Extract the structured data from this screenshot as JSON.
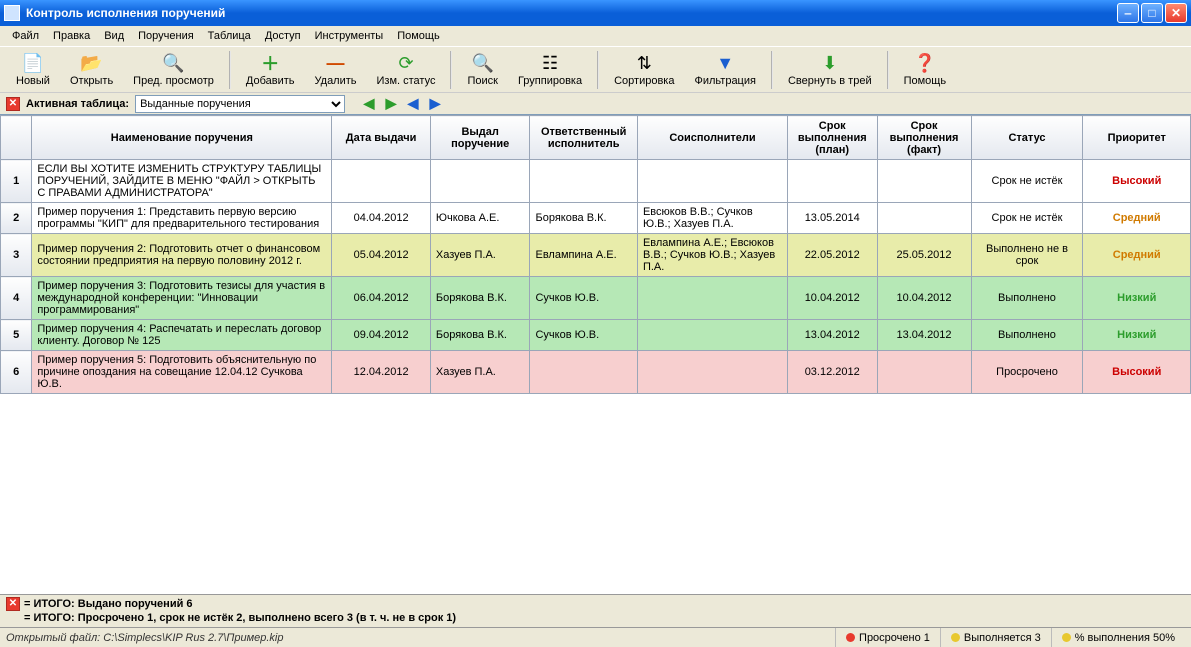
{
  "window": {
    "title": "Контроль исполнения поручений"
  },
  "menu": {
    "file": "Файл",
    "edit": "Правка",
    "view": "Вид",
    "orders": "Поручения",
    "table": "Таблица",
    "access": "Доступ",
    "tools": "Инструменты",
    "help": "Помощь"
  },
  "toolbar": {
    "new": "Новый",
    "open": "Открыть",
    "preview": "Пред. просмотр",
    "add": "Добавить",
    "delete": "Удалить",
    "chstatus": "Изм. статус",
    "search": "Поиск",
    "group": "Группировка",
    "sort": "Сортировка",
    "filter": "Фильтрация",
    "tray": "Свернуть в трей",
    "help": "Помощь"
  },
  "activebar": {
    "label": "Активная таблица:",
    "selected": "Выданные поручения"
  },
  "columns": {
    "idx": "",
    "name": "Наименование поручения",
    "date": "Дата выдачи",
    "issuer": "Выдал поручение",
    "responsible": "Ответственный исполнитель",
    "co": "Соисполнители",
    "plan": "Срок выполнения (план)",
    "fact": "Срок выполнения (факт)",
    "status": "Статус",
    "priority": "Приоритет"
  },
  "rows": [
    {
      "n": "1",
      "cls": "row-dashed",
      "name": "ЕСЛИ ВЫ ХОТИТЕ ИЗМЕНИТЬ СТРУКТУРУ ТАБЛИЦЫ ПОРУЧЕНИЙ, ЗАЙДИТЕ В МЕНЮ \"ФАЙЛ > ОТКРЫТЬ С ПРАВАМИ АДМИНИСТРАТОРА\"",
      "date": "",
      "issuer": "",
      "responsible": "",
      "co": "",
      "plan": "",
      "fact": "",
      "status": "Срок не истёк",
      "priority": "Высокий",
      "prioCls": "prio-high"
    },
    {
      "n": "2",
      "cls": "",
      "name": "Пример поручения 1: Представить первую версию программы \"КИП\" для предварительного тестирования",
      "date": "04.04.2012",
      "issuer": "Ючкова А.Е.",
      "responsible": "Борякова В.К.",
      "co": "Евсюков В.В.; Сучков Ю.В.; Хазуев П.А.",
      "plan": "13.05.2014",
      "fact": "",
      "status": "Срок не истёк",
      "priority": "Средний",
      "prioCls": "prio-med"
    },
    {
      "n": "3",
      "cls": "row-yellow",
      "name": "Пример поручения 2: Подготовить отчет о финансовом состоянии предприятия на первую половину 2012 г.",
      "date": "05.04.2012",
      "issuer": "Хазуев П.А.",
      "responsible": "Евлампина А.Е.",
      "co": "Евлампина А.Е.; Евсюков В.В.; Сучков Ю.В.; Хазуев П.А.",
      "plan": "22.05.2012",
      "fact": "25.05.2012",
      "status": "Выполнено не в срок",
      "priority": "Средний",
      "prioCls": "prio-med"
    },
    {
      "n": "4",
      "cls": "row-green",
      "name": "Пример поручения 3: Подготовить тезисы для участия в международной конференции: \"Инновации программирования\"",
      "date": "06.04.2012",
      "issuer": "Борякова В.К.",
      "responsible": "Сучков Ю.В.",
      "co": "",
      "plan": "10.04.2012",
      "fact": "10.04.2012",
      "status": "Выполнено",
      "priority": "Низкий",
      "prioCls": "prio-low"
    },
    {
      "n": "5",
      "cls": "row-green",
      "name": "Пример поручения 4: Распечатать и переслать договор клиенту. Договор № 125",
      "date": "09.04.2012",
      "issuer": "Борякова В.К.",
      "responsible": "Сучков Ю.В.",
      "co": "",
      "plan": "13.04.2012",
      "fact": "13.04.2012",
      "status": "Выполнено",
      "priority": "Низкий",
      "prioCls": "prio-low"
    },
    {
      "n": "6",
      "cls": "row-pink",
      "name": "Пример поручения 5: Подготовить объяснительную по причине опоздания на совещание 12.04.12 Сучкова Ю.В.",
      "date": "12.04.2012",
      "issuer": "Хазуев П.А.",
      "responsible": "",
      "co": "",
      "plan": "03.12.2012",
      "fact": "",
      "status": "Просрочено",
      "priority": "Высокий",
      "prioCls": "prio-high"
    }
  ],
  "summary": {
    "line1": "= ИТОГО: Выдано поручений 6",
    "line2": "= ИТОГО: Просрочено 1, срок не истёк 2, выполнено всего 3 (в т. ч. не в срок 1)"
  },
  "statusbar": {
    "file": "Открытый файл: C:\\Simplecs\\KIP Rus 2.7\\Пример.kip",
    "overdue": "Просрочено 1",
    "inprogress": "Выполняется 3",
    "percent": "% выполнения 50%"
  }
}
